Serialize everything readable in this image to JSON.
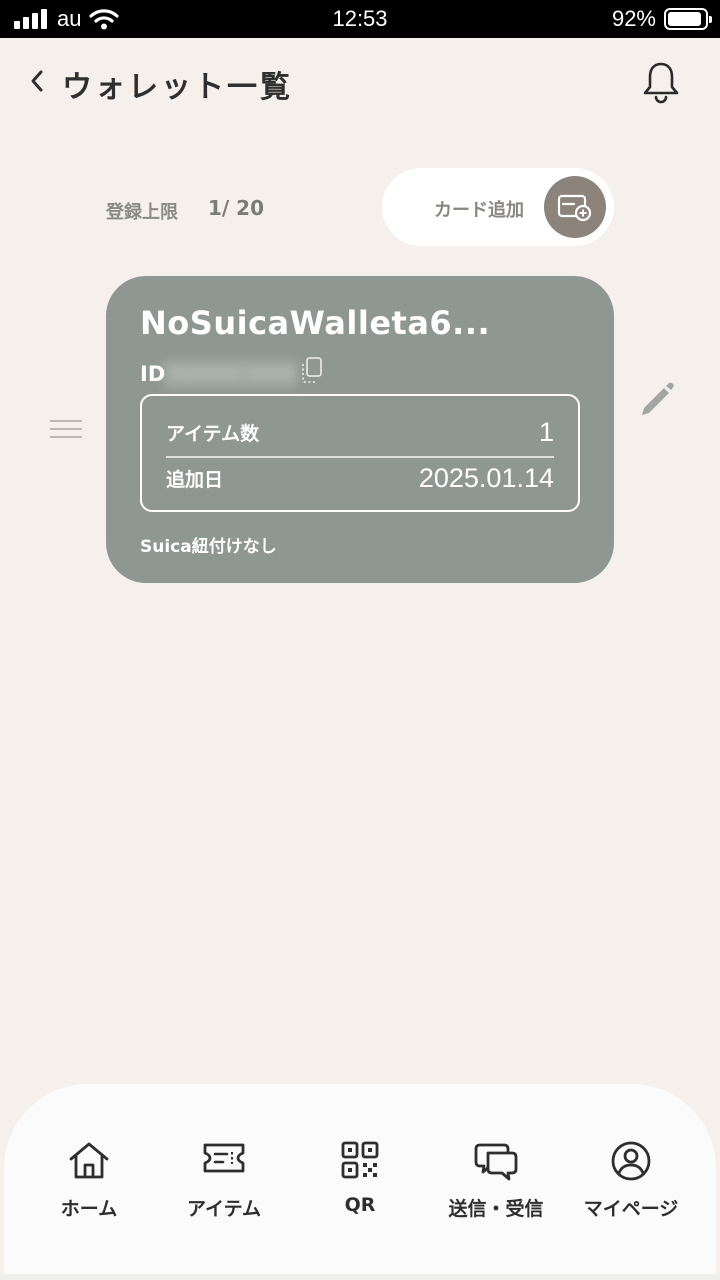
{
  "status_bar": {
    "carrier": "au",
    "time": "12:53",
    "battery_percent": "92%",
    "battery_level": 0.92,
    "signal_bars": 4
  },
  "header": {
    "title": "ウォレット一覧",
    "back_icon": "chevron-left-icon",
    "notification_icon": "bell-icon"
  },
  "limit": {
    "label": "登録上限",
    "value": "1/ 20"
  },
  "add_card": {
    "label": "カード追加",
    "icon": "card-add-icon",
    "circle_color": "#8c847b"
  },
  "wallet": {
    "name": "NoSuicaWalleta6...",
    "id_label": "ID",
    "id_value": "•••••• ••••",
    "item_count_label": "アイテム数",
    "item_count": "1",
    "added_date_label": "追加日",
    "added_date": "2025.01.14",
    "suica_status": "Suica紐付けなし",
    "card_color": "#8e9792"
  },
  "bottom_nav": {
    "items": [
      {
        "label": "ホーム",
        "icon": "home-icon"
      },
      {
        "label": "アイテム",
        "icon": "ticket-icon"
      },
      {
        "label": "QR",
        "icon": "qr-code-icon"
      },
      {
        "label": "送信・受信",
        "icon": "chat-bubbles-icon"
      },
      {
        "label": "マイページ",
        "icon": "user-circle-icon"
      }
    ]
  },
  "colors": {
    "background": "#f5f0eb",
    "nav_background": "#fafbfa",
    "accent": "#8c847b"
  }
}
